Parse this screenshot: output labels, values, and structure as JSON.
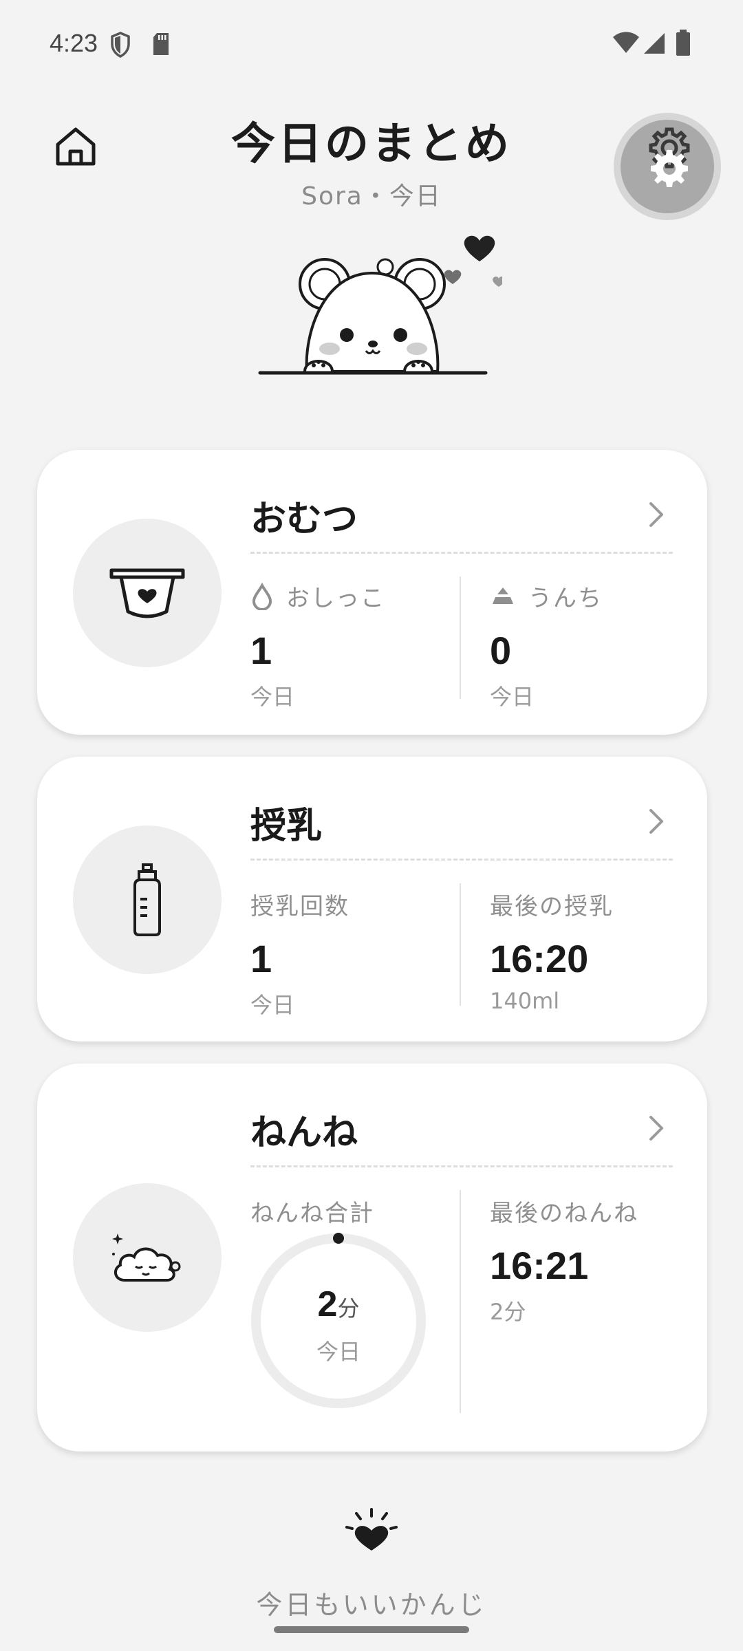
{
  "status_bar": {
    "time": "4:23"
  },
  "header": {
    "title": "今日のまとめ",
    "subtitle": "Sora・今日"
  },
  "cards": {
    "diaper": {
      "title": "おむつ",
      "pee_label": "おしっこ",
      "pee_count": "1",
      "pee_period": "今日",
      "poop_label": "うんち",
      "poop_count": "0",
      "poop_period": "今日"
    },
    "feeding": {
      "title": "授乳",
      "count_label": "授乳回数",
      "count": "1",
      "count_period": "今日",
      "last_label": "最後の授乳",
      "last_time": "16:20",
      "last_amount": "140ml"
    },
    "sleep": {
      "title": "ねんね",
      "total_label": "ねんね合計",
      "total_value": "2",
      "total_unit": "分",
      "total_period": "今日",
      "last_label": "最後のねんね",
      "last_time": "16:21",
      "last_duration": "2分"
    }
  },
  "footer": {
    "message": "今日もいいかんじ"
  },
  "icons": {
    "home": "home-icon",
    "settings": "gear-icon",
    "diaper": "diaper-icon",
    "bottle": "bottle-icon",
    "sleep": "sleeping-cloud-icon",
    "pee": "droplet-icon",
    "poop": "poop-icon",
    "cheer": "heart-sparkle-icon"
  }
}
